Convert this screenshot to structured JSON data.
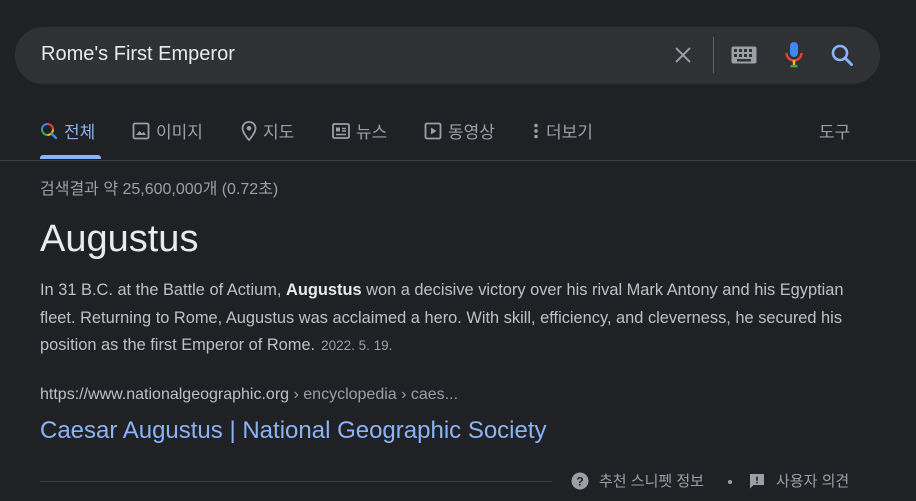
{
  "search": {
    "query": "Rome's First Emperor"
  },
  "tabs": [
    {
      "label": "전체",
      "icon": "search-icon",
      "active": true
    },
    {
      "label": "이미지",
      "icon": "image-icon"
    },
    {
      "label": "지도",
      "icon": "map-pin-icon"
    },
    {
      "label": "뉴스",
      "icon": "news-icon"
    },
    {
      "label": "동영상",
      "icon": "play-icon"
    },
    {
      "label": "더보기",
      "icon": "more-vert-icon"
    }
  ],
  "tools_label": "도구",
  "stats": "검색결과 약 25,600,000개 (0.72초)",
  "featured": {
    "heading": "Augustus",
    "snippet_pre": "In 31 B.C. at the Battle of Actium, ",
    "snippet_bold": "Augustus",
    "snippet_post": " won a decisive victory over his rival Mark Antony and his Egyptian fleet. Returning to Rome, Augustus was acclaimed a hero. With skill, efficiency, and cleverness, he secured his position as the first Emperor of Rome.",
    "date": "2022. 5. 19.",
    "cite_domain": "https://www.nationalgeographic.org",
    "cite_path": " › encyclopedia › caes...",
    "title": "Caesar Augustus | National Geographic Society"
  },
  "footer": {
    "snippet_info": "추천 스니펫 정보",
    "feedback": "사용자 의견"
  },
  "colors": {
    "background": "#202124",
    "search_bg": "#303134",
    "link": "#8ab4f8",
    "accent_active": "#8ab4f8"
  }
}
